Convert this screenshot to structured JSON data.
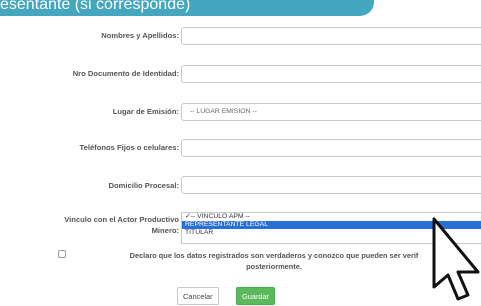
{
  "header": {
    "title": "esentante (si corresponde)"
  },
  "fields": {
    "nombres": {
      "label": "Nombres y Apellidos:"
    },
    "documento": {
      "label": "Nro Documento de Identidad:"
    },
    "lugar": {
      "label": "Lugar de Emisión:",
      "value": "-- LUGAR EMISION --"
    },
    "telefonos": {
      "label": "Teléfonos Fijos o celulares:"
    },
    "domicilio": {
      "label": "Domicilio Procesal:"
    },
    "vinculo": {
      "label_line1": "Vinculo con el Actor Productivo",
      "label_line2": "Minero:",
      "options": [
        "✓-- VINCULO APM --",
        "REPRESENTANTE LEGAL",
        "TITULAR"
      ]
    }
  },
  "declaration": {
    "line1": "Declaro que los datos registrados son verdaderos y conozco que pueden ser verif",
    "line2": "posteriormente."
  },
  "buttons": {
    "cancel": "Cancelar",
    "save": "Guardar"
  },
  "icons": {
    "cursor": "mouse-pointer-icon",
    "chevron": "chevron-down-icon"
  },
  "colors": {
    "header_bg": "#45a7bf",
    "save_bg": "#5cb85c",
    "selected_option_bg": "#2a6fd6"
  }
}
